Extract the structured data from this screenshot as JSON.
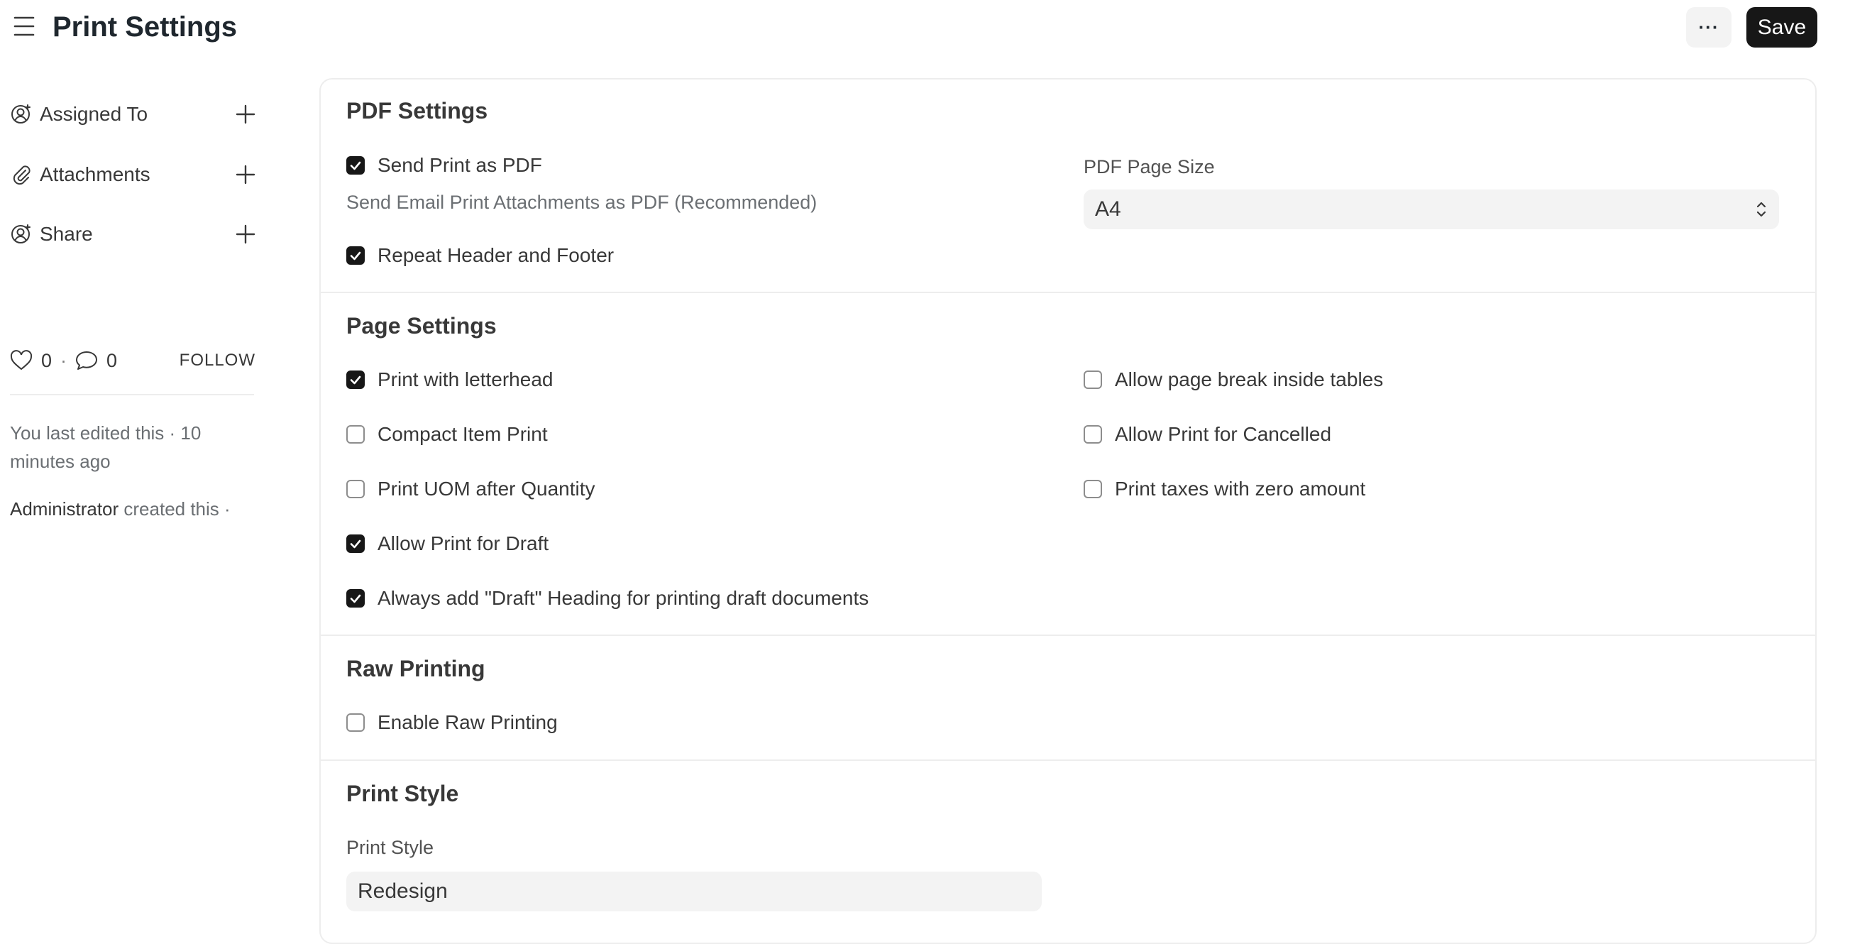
{
  "header": {
    "title": "Print Settings",
    "more_label": "···",
    "save_label": "Save"
  },
  "sidebar": {
    "items": [
      {
        "label": "Assigned To",
        "icon": "assign-user-icon"
      },
      {
        "label": "Attachments",
        "icon": "paperclip-icon"
      },
      {
        "label": "Share",
        "icon": "share-user-icon"
      }
    ],
    "likes": "0",
    "comments": "0",
    "follow_label": "FOLLOW",
    "last_edited": "You last edited this · 10 minutes ago",
    "created_by_user": "Administrator",
    "created_by_text": "created this ·"
  },
  "sections": {
    "pdf": {
      "title": "PDF Settings",
      "send_print_as_pdf": {
        "label": "Send Print as PDF",
        "checked": true
      },
      "send_print_help": "Send Email Print Attachments as PDF (Recommended)",
      "repeat_header_footer": {
        "label": "Repeat Header and Footer",
        "checked": true
      },
      "page_size_label": "PDF Page Size",
      "page_size_value": "A4"
    },
    "page": {
      "title": "Page Settings",
      "left": [
        {
          "label": "Print with letterhead",
          "checked": true
        },
        {
          "label": "Compact Item Print",
          "checked": false
        },
        {
          "label": "Print UOM after Quantity",
          "checked": false
        },
        {
          "label": "Allow Print for Draft",
          "checked": true
        },
        {
          "label": "Always add \"Draft\" Heading for printing draft documents",
          "checked": true
        }
      ],
      "right": [
        {
          "label": "Allow page break inside tables",
          "checked": false
        },
        {
          "label": "Allow Print for Cancelled",
          "checked": false
        },
        {
          "label": "Print taxes with zero amount",
          "checked": false
        }
      ]
    },
    "raw": {
      "title": "Raw Printing",
      "enable_raw": {
        "label": "Enable Raw Printing",
        "checked": false
      }
    },
    "style": {
      "title": "Print Style",
      "field_label": "Print Style",
      "value": "Redesign"
    }
  }
}
